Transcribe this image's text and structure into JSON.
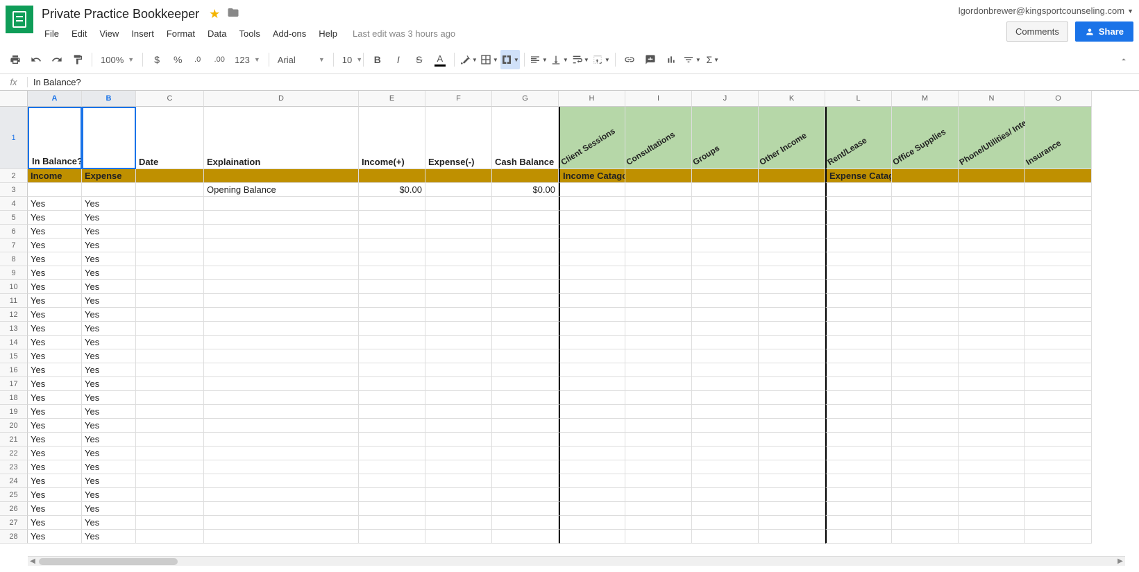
{
  "doc": {
    "title": "Private Practice Bookkeeper",
    "last_edit": "Last edit was 3 hours ago",
    "user_email": "lgordonbrewer@kingsportcounseling.com"
  },
  "buttons": {
    "comments": "Comments",
    "share": "Share"
  },
  "menu": [
    "File",
    "Edit",
    "View",
    "Insert",
    "Format",
    "Data",
    "Tools",
    "Add-ons",
    "Help"
  ],
  "toolbar": {
    "zoom": "100%",
    "font": "Arial",
    "size": "10",
    "more_formats": "123"
  },
  "formula": {
    "label": "fx",
    "value": "In Balance?"
  },
  "columns": [
    "A",
    "B",
    "C",
    "D",
    "E",
    "F",
    "G",
    "H",
    "I",
    "J",
    "K",
    "L",
    "M",
    "N",
    "O"
  ],
  "row1_headers": {
    "A": "In Balance?",
    "C": "Date",
    "D": "Explaination",
    "E": "Income(+)",
    "F": "Expense(-)",
    "G": "Cash Balance",
    "H": "Client Sessions",
    "I": "Consultations",
    "J": "Groups",
    "K": "Other Income",
    "L": "Rent/Lease",
    "M": "Office Supplies",
    "N": "Phone/Utilities/ Internet",
    "O": "Insurance"
  },
  "row2": {
    "A": "Income",
    "B": "Expense",
    "H": "Income Catagories",
    "L": "Expense Catagories"
  },
  "row3": {
    "D": "Opening Balance",
    "E": "$0.00",
    "G": "$0.00"
  },
  "yes": "Yes",
  "row_numbers": [
    "1",
    "2",
    "3",
    "4",
    "5",
    "6",
    "7",
    "8",
    "9",
    "10",
    "11",
    "12",
    "13",
    "14",
    "15",
    "16",
    "17",
    "18",
    "19",
    "20",
    "21",
    "22",
    "23",
    "24",
    "25",
    "26",
    "27",
    "28"
  ]
}
